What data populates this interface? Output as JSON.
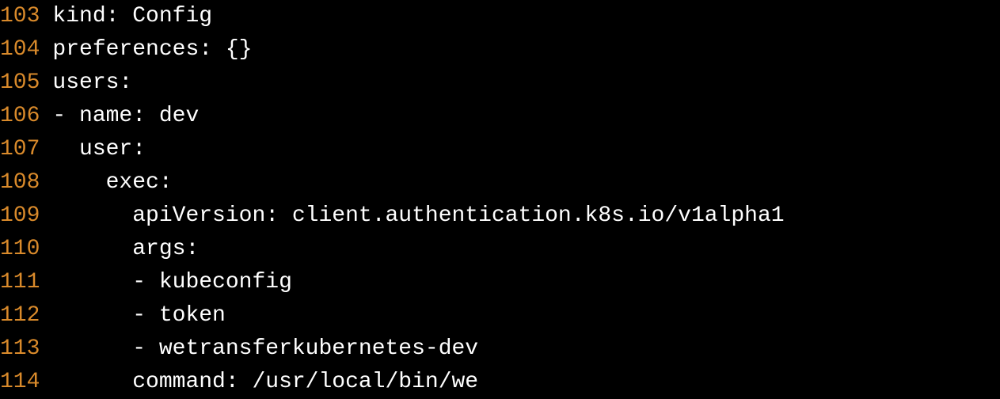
{
  "lines": [
    {
      "num": "103",
      "text": "kind: Config"
    },
    {
      "num": "104",
      "text": "preferences: {}"
    },
    {
      "num": "105",
      "text": "users:"
    },
    {
      "num": "106",
      "text": "- name: dev"
    },
    {
      "num": "107",
      "text": "  user:"
    },
    {
      "num": "108",
      "text": "    exec:"
    },
    {
      "num": "109",
      "text": "      apiVersion: client.authentication.k8s.io/v1alpha1"
    },
    {
      "num": "110",
      "text": "      args:"
    },
    {
      "num": "111",
      "text": "      - kubeconfig"
    },
    {
      "num": "112",
      "text": "      - token"
    },
    {
      "num": "113",
      "text": "      - wetransferkubernetes-dev"
    },
    {
      "num": "114",
      "text": "      command: /usr/local/bin/we"
    }
  ]
}
